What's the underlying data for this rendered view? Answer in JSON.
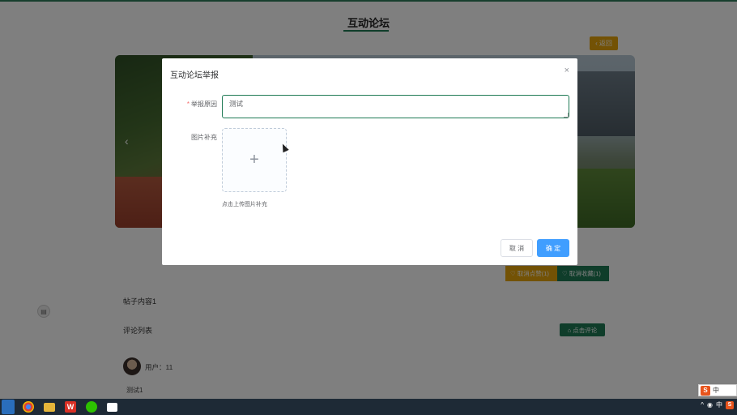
{
  "page": {
    "title": "互动论坛",
    "back_label": "返回",
    "favorite_label": "取消点赞(1)",
    "collect_label": "取消收藏(1)",
    "post_content": "帖子内容1",
    "comment_list_label": "评论列表",
    "comment_button_label": "点击评论",
    "side_icon": "doc-icon",
    "comment": {
      "user": "用户：11",
      "text": "测试1"
    }
  },
  "dialog": {
    "title": "互动论坛举报",
    "close_icon": "×",
    "reason_label": "举报原因",
    "reason_required_mark": "*",
    "reason_value": "测试",
    "images_label": "图片补充",
    "upload_icon": "+",
    "upload_hint": "点击上传图片补充",
    "cancel_label": "取 消",
    "confirm_label": "确 定"
  },
  "taskbar": {
    "wps_glyph": "W",
    "tray_text": "中"
  },
  "ime": {
    "logo": "S",
    "mode": "中"
  },
  "colors": {
    "primary_green": "#1f7a55",
    "warning_orange": "#e6a50a",
    "confirm_blue": "#409eff"
  }
}
